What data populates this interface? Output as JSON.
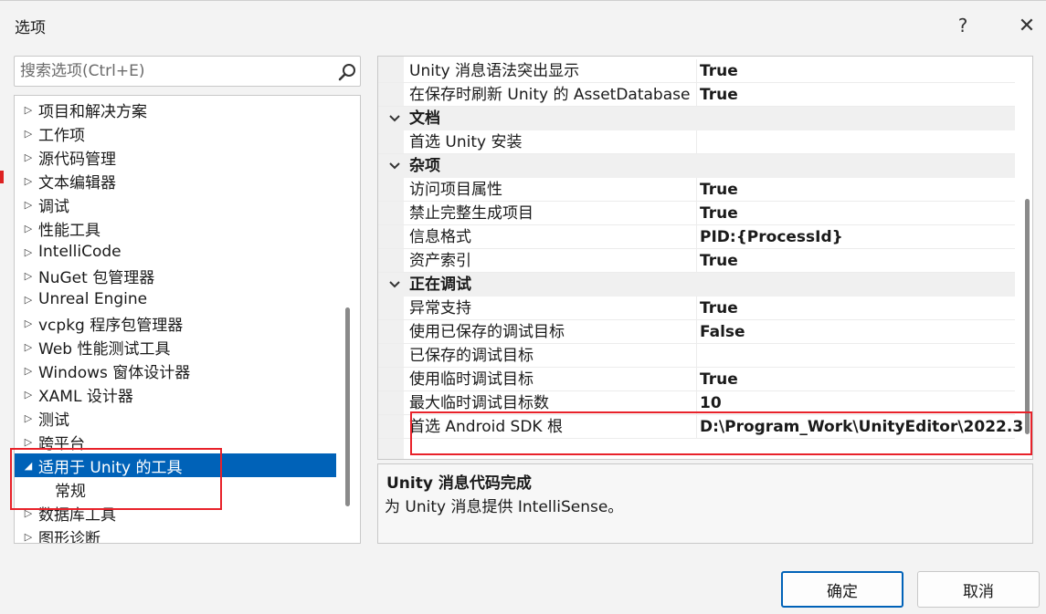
{
  "window": {
    "title": "选项",
    "help_label": "?",
    "close_label": "✕"
  },
  "search": {
    "placeholder": "搜索选项(Ctrl+E)"
  },
  "tree": {
    "items": [
      {
        "label": "项目和解决方案",
        "expanded": false
      },
      {
        "label": "工作项",
        "expanded": false
      },
      {
        "label": "源代码管理",
        "expanded": false
      },
      {
        "label": "文本编辑器",
        "expanded": false
      },
      {
        "label": "调试",
        "expanded": false
      },
      {
        "label": "性能工具",
        "expanded": false
      },
      {
        "label": "IntelliCode",
        "expanded": false
      },
      {
        "label": "NuGet 包管理器",
        "expanded": false
      },
      {
        "label": "Unreal Engine",
        "expanded": false
      },
      {
        "label": "vcpkg 程序包管理器",
        "expanded": false
      },
      {
        "label": "Web 性能测试工具",
        "expanded": false
      },
      {
        "label": "Windows 窗体设计器",
        "expanded": false
      },
      {
        "label": "XAML 设计器",
        "expanded": false
      },
      {
        "label": "测试",
        "expanded": false
      },
      {
        "label": "跨平台",
        "expanded": false
      },
      {
        "label": "适用于 Unity 的工具",
        "expanded": true
      },
      {
        "label": "常规",
        "child": true
      },
      {
        "label": "数据库工具",
        "expanded": false
      },
      {
        "label": "图形诊断",
        "expanded": false
      }
    ]
  },
  "grid": {
    "rows": [
      {
        "type": "prop",
        "name": "Unity 消息语法突出显示",
        "value": "True"
      },
      {
        "type": "prop",
        "name": "在保存时刷新 Unity 的 AssetDatabase",
        "value": "True"
      },
      {
        "type": "cat",
        "name": "文档"
      },
      {
        "type": "prop",
        "name": "首选 Unity 安装",
        "value": ""
      },
      {
        "type": "cat",
        "name": "杂项"
      },
      {
        "type": "prop",
        "name": "访问项目属性",
        "value": "True"
      },
      {
        "type": "prop",
        "name": "禁止完整生成项目",
        "value": "True"
      },
      {
        "type": "prop",
        "name": "信息格式",
        "value": "PID:{ProcessId}"
      },
      {
        "type": "prop",
        "name": "资产索引",
        "value": "True"
      },
      {
        "type": "cat",
        "name": "正在调试"
      },
      {
        "type": "prop",
        "name": "异常支持",
        "value": "True"
      },
      {
        "type": "prop",
        "name": "使用已保存的调试目标",
        "value": "False"
      },
      {
        "type": "prop",
        "name": "已保存的调试目标",
        "value": ""
      },
      {
        "type": "prop",
        "name": "使用临时调试目标",
        "value": "True"
      },
      {
        "type": "prop",
        "name": "最大临时调试目标数",
        "value": "10"
      },
      {
        "type": "prop",
        "name": "首选 Android SDK 根",
        "value": "D:\\Program_Work\\UnityEditor\\2022.3"
      }
    ]
  },
  "description": {
    "title": "Unity 消息代码完成",
    "text": "为 Unity 消息提供 IntelliSense。"
  },
  "buttons": {
    "ok": "确定",
    "cancel": "取消"
  },
  "colors": {
    "selection": "#0062b8",
    "highlight": "#e8222a"
  }
}
